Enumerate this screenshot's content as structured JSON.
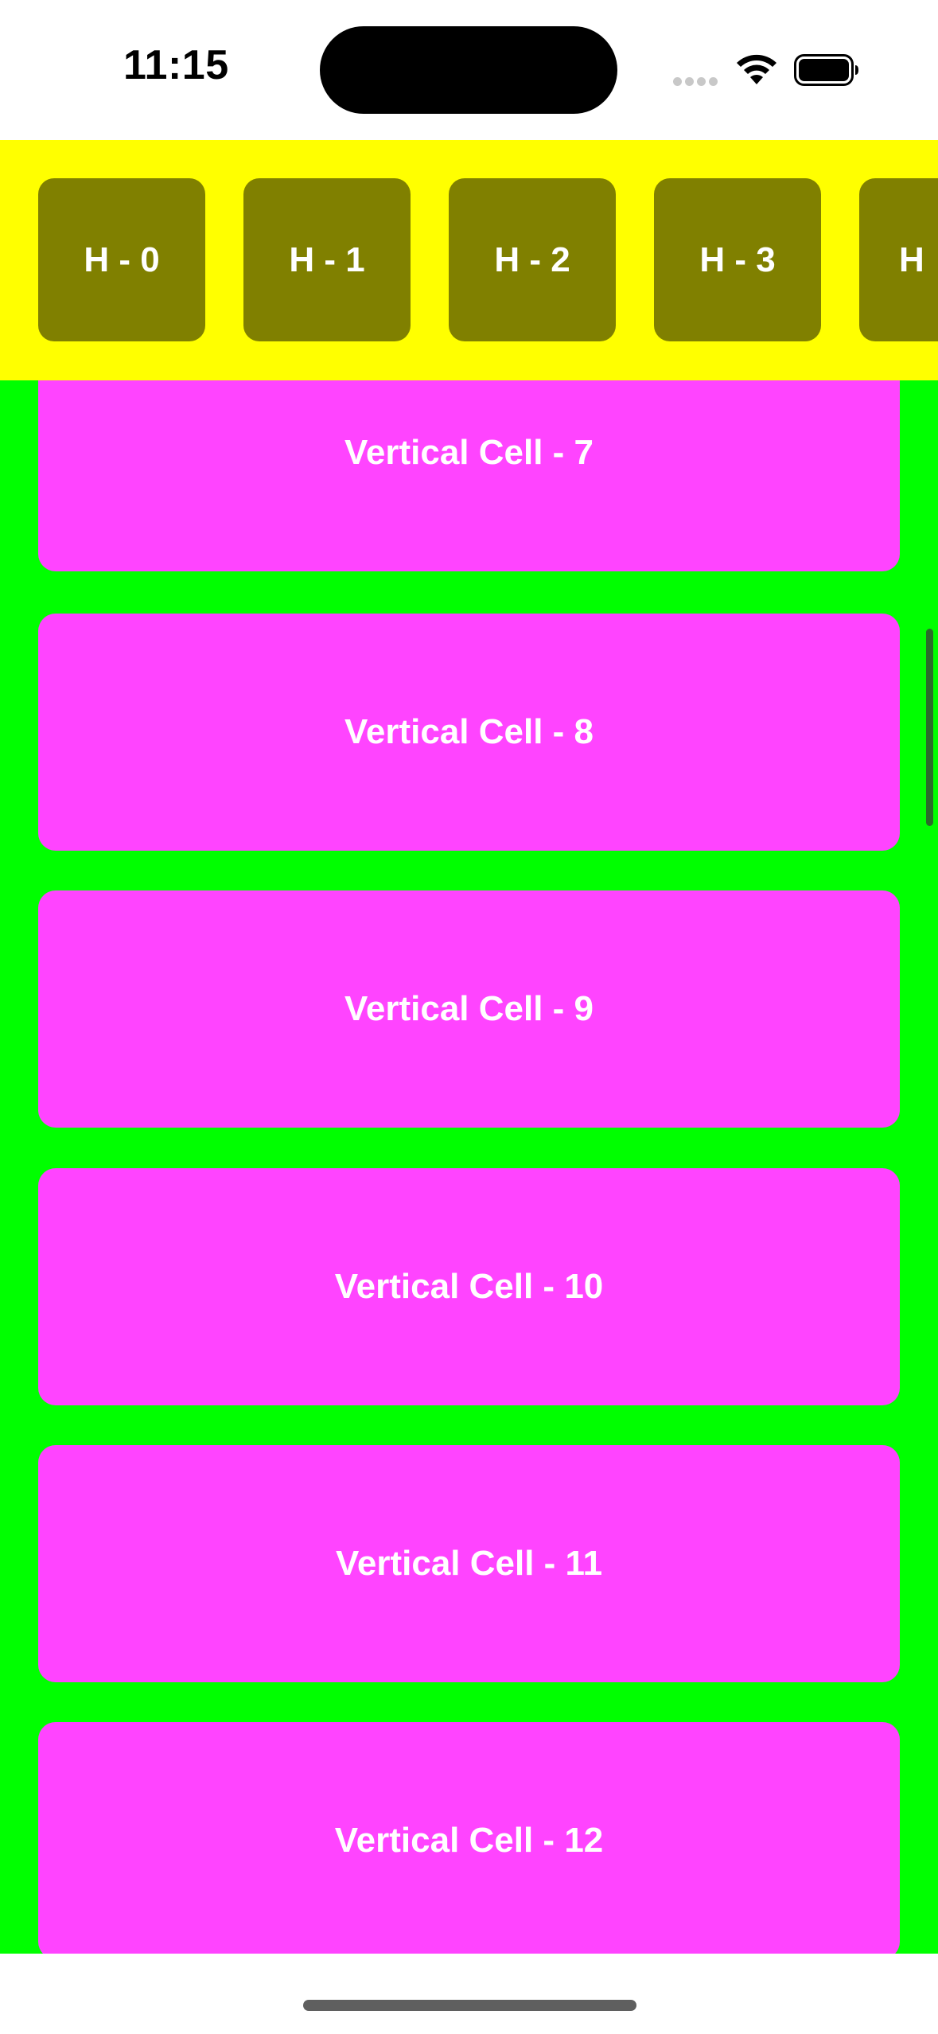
{
  "status_bar": {
    "time": "11:15",
    "icons": [
      "cellular-signal-icon",
      "wifi-icon",
      "battery-icon"
    ]
  },
  "horizontal_collection": {
    "background_color": "#ffff00",
    "cell_color": "#808000",
    "items": [
      {
        "label": "H - 0"
      },
      {
        "label": "H - 1"
      },
      {
        "label": "H - 2"
      },
      {
        "label": "H - 3"
      },
      {
        "label": "H"
      }
    ]
  },
  "vertical_collection": {
    "background_color": "#00ff00",
    "cell_color": "#ff44ff",
    "items": [
      {
        "label": "Vertical Cell - 7"
      },
      {
        "label": "Vertical Cell - 8"
      },
      {
        "label": "Vertical Cell - 9"
      },
      {
        "label": "Vertical Cell - 10"
      },
      {
        "label": "Vertical Cell - 11"
      },
      {
        "label": "Vertical Cell - 12"
      }
    ]
  }
}
